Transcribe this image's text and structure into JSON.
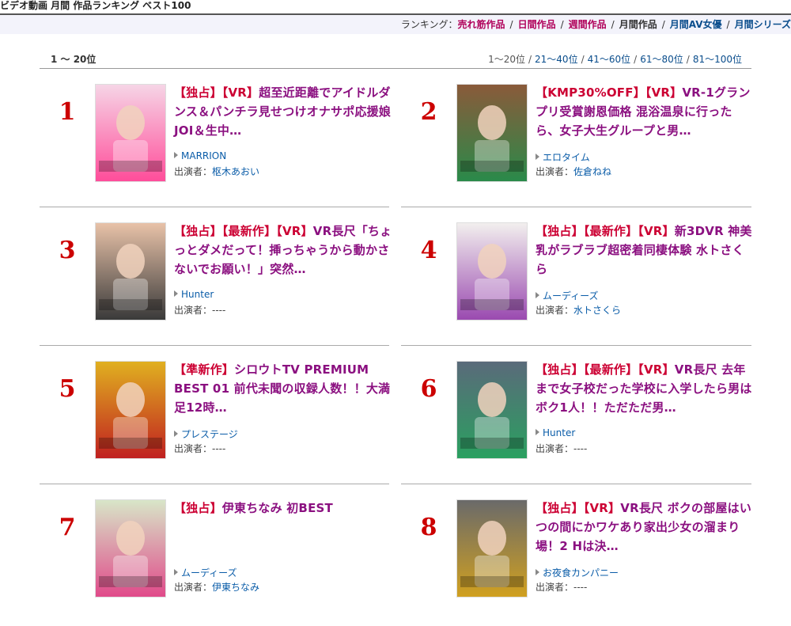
{
  "page_title": "ビデオ動画 月間 作品ランキング ベスト100",
  "ranking_nav": {
    "prefix": "ランキング：",
    "links": [
      {
        "label": "売れ筋作品",
        "style": "pink"
      },
      {
        "label": "日間作品",
        "style": "pink"
      },
      {
        "label": "週間作品",
        "style": "pink"
      },
      {
        "label": "月間作品",
        "style": "current"
      },
      {
        "label": "月間AV女優",
        "style": "blue"
      },
      {
        "label": "月間シリーズ",
        "style": "blue"
      }
    ]
  },
  "range_label": "1 ～ 20位",
  "pager": {
    "current": "1～20位",
    "links": [
      "21～40位",
      "41～60位",
      "61～80位",
      "81～100位"
    ]
  },
  "cast_prefix": "出演者：",
  "items": [
    {
      "rank": "1",
      "tags": "【独占】【VR】",
      "title": "超至近距離でアイドルダンス＆パンチラ見せつけオナサポ応援娘 JOI＆生中…",
      "maker": "MARRION",
      "cast": "枢木あおい",
      "cast_linked": true,
      "thumb_colors": [
        "#f6d5e6",
        "#ff4d9a"
      ]
    },
    {
      "rank": "2",
      "tags": "【KMP30%OFF】【VR】",
      "title": "VR-1グランプリ受賞謝恩価格 混浴温泉に行ったら、女子大生グループと男…",
      "maker": "エロタイム",
      "cast": "佐倉ねね",
      "cast_linked": true,
      "thumb_colors": [
        "#8a5a3a",
        "#2a8a4a"
      ]
    },
    {
      "rank": "3",
      "tags": "【独占】【最新作】【VR】",
      "title": "VR長尺「ちょっとダメだって！挿っちゃうから動かさないでお願い！」突然…",
      "maker": "Hunter",
      "cast": "----",
      "cast_linked": false,
      "thumb_colors": [
        "#e8c2a8",
        "#3a3a3a"
      ]
    },
    {
      "rank": "4",
      "tags": "【独占】【最新作】【VR】",
      "title": "新3DVR 神美乳がラブラブ超密着同棲体験 水トさくら",
      "maker": "ムーディーズ",
      "cast": "水トさくら",
      "cast_linked": true,
      "thumb_colors": [
        "#f2efee",
        "#9a4ab0"
      ]
    },
    {
      "rank": "5",
      "tags": "【準新作】",
      "title": "シロウトTV PREMIUM BEST 01 前代未聞の収録人数！！大満足12時…",
      "maker": "プレステージ",
      "cast": "----",
      "cast_linked": false,
      "thumb_colors": [
        "#e0b020",
        "#c02020"
      ]
    },
    {
      "rank": "6",
      "tags": "【独占】【最新作】【VR】",
      "title": "VR長尺 去年まで女子校だった学校に入学したら男はボク1人！！ただただ男…",
      "maker": "Hunter",
      "cast": "----",
      "cast_linked": false,
      "thumb_colors": [
        "#5a6a7a",
        "#2aa060"
      ]
    },
    {
      "rank": "7",
      "tags": "【独占】",
      "title": "伊東ちなみ 初BEST",
      "maker": "ムーディーズ",
      "cast": "伊東ちなみ",
      "cast_linked": true,
      "thumb_colors": [
        "#d8e6c8",
        "#e04a8a"
      ]
    },
    {
      "rank": "8",
      "tags": "【独占】【VR】",
      "title": "VR長尺 ボクの部屋はいつの間にかワケあり家出少女の溜まり場！2 Hは決…",
      "maker": "お夜食カンパニー",
      "cast": "----",
      "cast_linked": false,
      "thumb_colors": [
        "#6a6a6a",
        "#d0a020"
      ]
    }
  ]
}
